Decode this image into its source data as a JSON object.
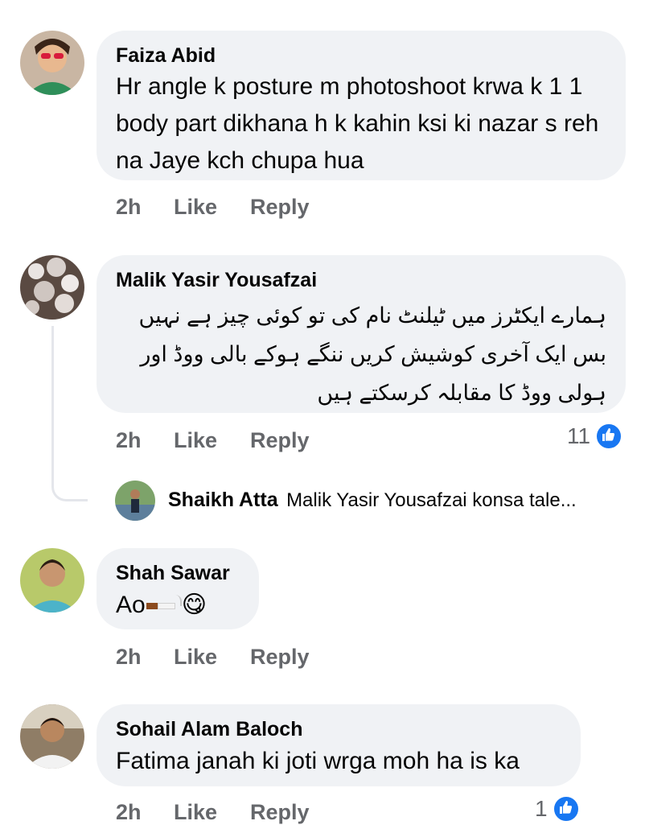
{
  "comments": [
    {
      "author": "Faiza Abid",
      "text": "Hr angle k posture m photoshoot krwa k 1 1 body part dikhana h k kahin ksi ki nazar s reh na Jaye kch chupa hua",
      "time": "2h",
      "like": "Like",
      "reply": "Reply"
    },
    {
      "author": "Malik Yasir Yousafzai",
      "text": "ہمارے ایکٹرز میں ٹیلنٹ نام کی تو کوئی چیز ہے نہیں بس ایک آخری کوشیش کریں ننگے ہوکے بالی ووڈ اور ہولی ووڈ کا مقابلہ کرسکتے ہیں",
      "time": "2h",
      "like": "Like",
      "reply": "Reply",
      "reaction_count": "11"
    },
    {
      "author": "Shah Sawar",
      "text": "Ao",
      "emoji": "😋",
      "time": "2h",
      "like": "Like",
      "reply": "Reply"
    },
    {
      "author": "Sohail Alam Baloch",
      "text": "Fatima janah ki joti wrga moh ha is ka",
      "time": "2h",
      "like": "Like",
      "reply": "Reply",
      "reaction_count": "1"
    }
  ],
  "reply_preview": {
    "author": "Shaikh Atta",
    "text": "Malik Yasir Yousafzai konsa tale..."
  },
  "colors": {
    "bubble": "#f0f2f5",
    "meta": "#65676b",
    "like_blue": "#1877f2"
  }
}
